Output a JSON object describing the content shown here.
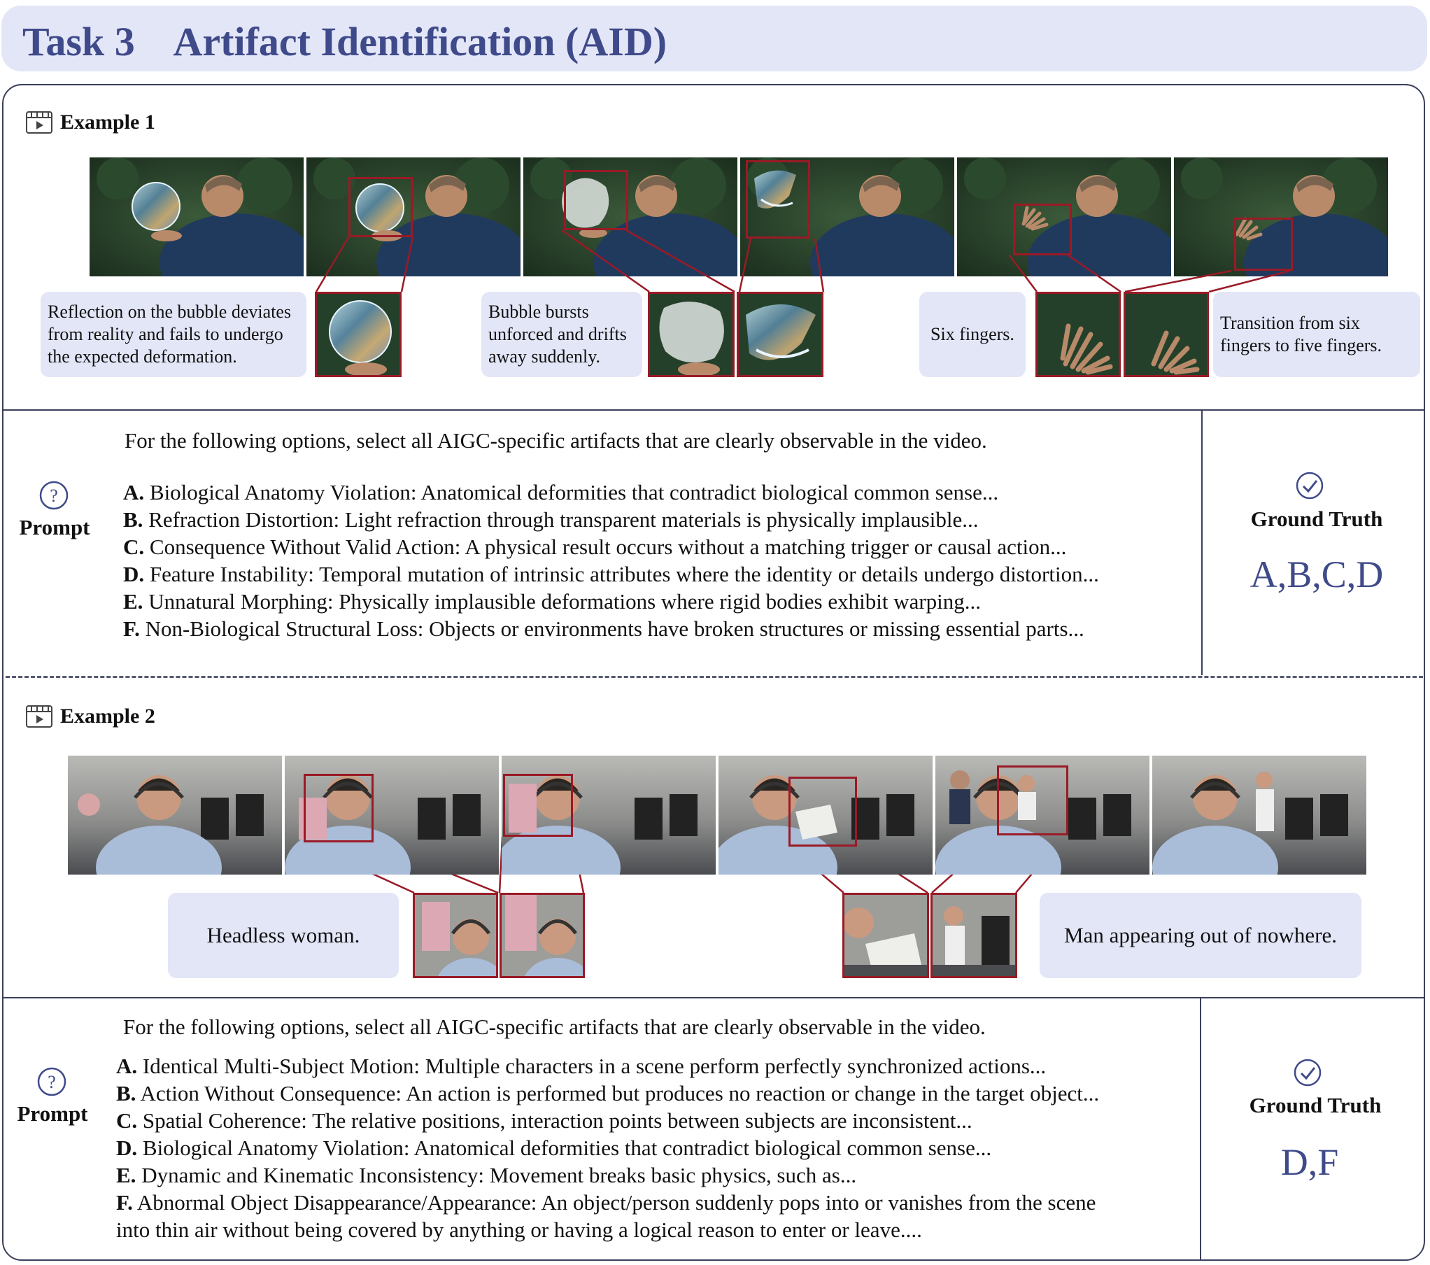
{
  "header": {
    "task": "Task 3",
    "title": "Artifact Identification (AID)"
  },
  "example1": {
    "label": "Example 1",
    "callouts": [
      "Reflection on the bubble deviates from reality and fails to undergo the expected deformation.",
      "Bubble bursts unforced and drifts away suddenly.",
      "Six fingers.",
      "Transition from six fingers to five fingers."
    ],
    "prompt_label": "Prompt",
    "instruction": "For the following options, select all AIGC-specific artifacts that are clearly observable in the video.",
    "options": [
      {
        "letter": "A.",
        "text": " Biological Anatomy Violation: Anatomical deformities that contradict biological common sense..."
      },
      {
        "letter": "B.",
        "text": " Refraction Distortion: Light refraction through transparent materials is physically implausible..."
      },
      {
        "letter": "C.",
        "text": " Consequence Without Valid Action: A physical result occurs without a matching trigger or causal action..."
      },
      {
        "letter": "D.",
        "text": " Feature Instability: Temporal mutation of intrinsic attributes where the identity or details undergo distortion..."
      },
      {
        "letter": "E.",
        "text": " Unnatural Morphing: Physically implausible deformations where rigid bodies exhibit warping..."
      },
      {
        "letter": "F.",
        "text": " Non-Biological Structural Loss: Objects or environments have broken structures or missing essential parts..."
      }
    ],
    "ground_truth_label": "Ground Truth",
    "ground_truth": "A,B,C,D"
  },
  "example2": {
    "label": "Example 2",
    "callouts": [
      "Headless woman.",
      "Man appearing out of nowhere."
    ],
    "prompt_label": "Prompt",
    "instruction": "For the following options, select all AIGC-specific artifacts that are clearly observable in the video.",
    "options": [
      {
        "letter": "A.",
        "text": " Identical Multi-Subject Motion: Multiple characters in a scene perform perfectly synchronized actions..."
      },
      {
        "letter": "B.",
        "text": " Action Without Consequence: An action is performed but produces no reaction or change in the target object..."
      },
      {
        "letter": "C.",
        "text": " Spatial Coherence: The relative positions, interaction points between subjects are inconsistent..."
      },
      {
        "letter": "D.",
        "text": " Biological Anatomy Violation: Anatomical deformities that contradict biological common sense..."
      },
      {
        "letter": "E.",
        "text": " Dynamic and Kinematic Inconsistency: Movement breaks basic physics, such as..."
      },
      {
        "letter": "F.",
        "text": " Abnormal Object Disappearance/Appearance: An object/person suddenly pops into or vanishes from the scene"
      }
    ],
    "option_f_continuation": "into thin air without being covered by anything or having a logical reason to enter or leave....",
    "ground_truth_label": "Ground Truth",
    "ground_truth": "D,F"
  },
  "colors": {
    "accent": "#3f4a8a",
    "callout_bg": "#e3e6f7",
    "highlight": "#9a1a26"
  }
}
